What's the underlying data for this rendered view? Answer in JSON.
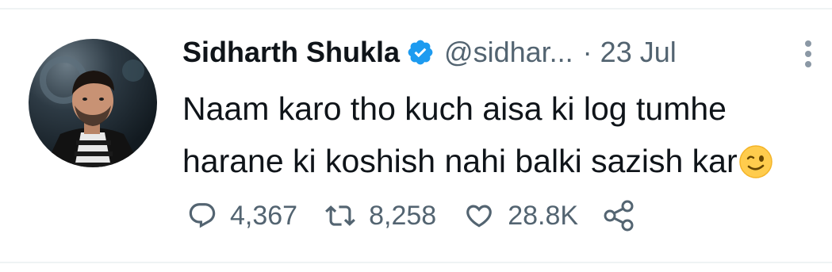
{
  "tweet": {
    "author_name": "Sidharth Shukla",
    "verified": true,
    "handle": "@sidhar...",
    "separator": "·",
    "date": "23 Jul",
    "text_lines": [
      "Naam karo tho kuch aisa ki log tumhe",
      "harane ki koshish nahi balki sazish kar"
    ],
    "emoji": "winking-face",
    "stats": {
      "replies": "4,367",
      "retweets": "8,258",
      "likes": "28.8K"
    }
  },
  "icons": {
    "verified": "verified-badge-icon",
    "more": "more-options-icon",
    "reply": "reply-icon",
    "retweet": "retweet-icon",
    "like": "like-icon",
    "share": "share-icon"
  },
  "colors": {
    "verified_blue": "#1d9bf0",
    "text_primary": "#0f1419",
    "text_secondary": "#536471",
    "divider": "#eff3f4"
  }
}
